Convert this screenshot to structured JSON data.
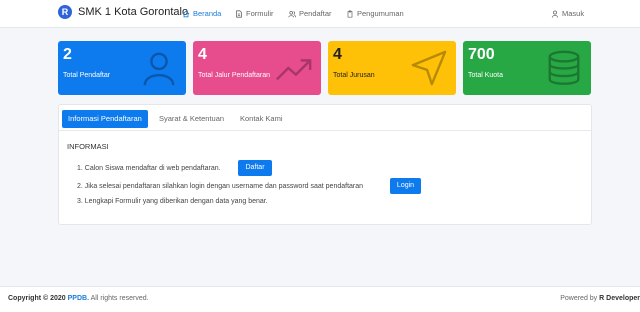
{
  "brand": {
    "logo_letter": "R",
    "title": "SMK 1 Kota Gorontalo"
  },
  "nav": {
    "items": [
      {
        "label": "Beranda",
        "icon": "home-icon"
      },
      {
        "label": "Formulir",
        "icon": "document-icon"
      },
      {
        "label": "Pendaftar",
        "icon": "users-icon"
      },
      {
        "label": "Pengumuman",
        "icon": "clipboard-icon"
      }
    ],
    "login": {
      "label": "Masuk",
      "icon": "user-icon"
    }
  },
  "colors": {
    "primary": "#0d7aee",
    "pink": "#e74c8d",
    "yellow": "#ffc107",
    "green": "#28a745"
  },
  "stats": [
    {
      "value": "2",
      "label": "Total Pendaftar",
      "icon": "user-icon",
      "color": "#0d7aee"
    },
    {
      "value": "4",
      "label": "Total Jalur Pendaftaran",
      "icon": "trend-up-icon",
      "color": "#e74c8d"
    },
    {
      "value": "4",
      "label": "Total Jurusan",
      "icon": "send-icon",
      "color": "#ffc107"
    },
    {
      "value": "700",
      "label": "Total Kuota",
      "icon": "database-icon",
      "color": "#28a745"
    }
  ],
  "tabs": [
    {
      "label": "Informasi Pendaftaran"
    },
    {
      "label": "Syarat & Ketentuan"
    },
    {
      "label": "Kontak Kami"
    }
  ],
  "info": {
    "title": "INFORMASI",
    "steps": [
      {
        "text": "1. Calon Siswa mendaftar di web pendaftaran.",
        "button": "Daftar"
      },
      {
        "text": "2. Jika selesai pendaftaran silahkan login dengan username dan password saat pendaftaran",
        "button": "Login"
      },
      {
        "text": "3. Lengkapi Formulir yang diberikan dengan data yang benar."
      }
    ]
  },
  "footer": {
    "copyright_prefix": "Copyright © 2020",
    "brand_link": "PPDB.",
    "copyright_suffix": " All rights reserved.",
    "powered_prefix": "Powered by ",
    "powered_name": "R Developer"
  }
}
